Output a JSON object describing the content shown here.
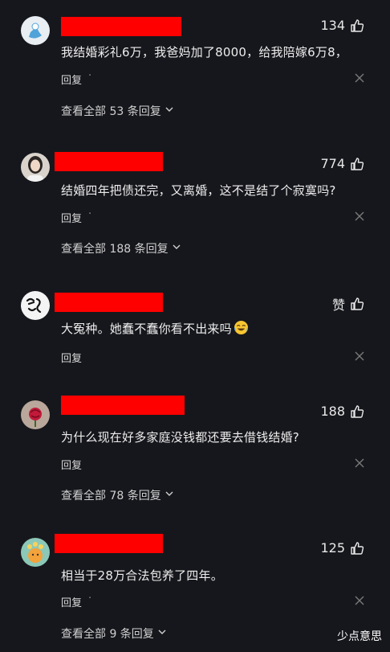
{
  "colors": {
    "background": "#16171c",
    "redaction": "#ff0000",
    "text": "#ededed",
    "muted": "#8a8a8a"
  },
  "reply_label": "回复",
  "comments": [
    {
      "likes": "134",
      "text": "我结婚彩礼6万，我爸妈加了8000，给我陪嫁6万8，",
      "view_all": "查看全部 53 条回复"
    },
    {
      "likes": "774",
      "text": "结婚四年把债还完，又离婚，这不是结了个寂寞吗?",
      "view_all": "查看全部 188 条回复"
    },
    {
      "likes": "赞",
      "text": "大冤种。她蠢不蠢你看不出来吗",
      "emoji": "laughing-crying-emoji"
    },
    {
      "likes": "188",
      "text": "为什么现在好多家庭没钱都还要去借钱结婚?",
      "view_all": "查看全部 78 条回复"
    },
    {
      "likes": "125",
      "text": "相当于28万合法包养了四年。",
      "view_all": "查看全部 9 条回复"
    }
  ],
  "watermark": "少点意思"
}
